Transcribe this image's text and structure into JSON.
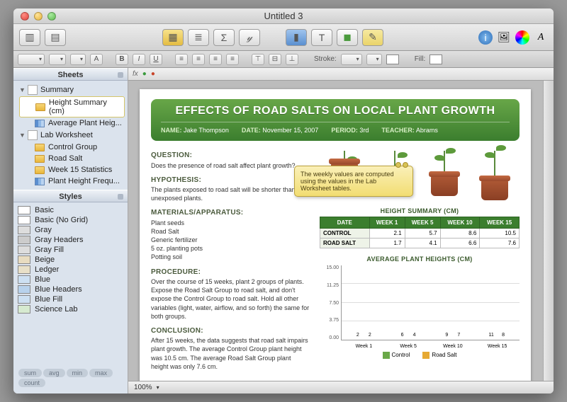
{
  "window": {
    "title": "Untitled 3"
  },
  "formatBar": {
    "stroke_label": "Stroke:",
    "fill_label": "Fill:"
  },
  "sidebar": {
    "sheets_header": "Sheets",
    "styles_header": "Styles",
    "groups": [
      {
        "name": "Summary",
        "items": [
          {
            "label": "Height Summary (cm)",
            "type": "table",
            "selected": true
          },
          {
            "label": "Average Plant Heig...",
            "type": "chart"
          }
        ]
      },
      {
        "name": "Lab Worksheet",
        "items": [
          {
            "label": "Control Group",
            "type": "table"
          },
          {
            "label": "Road Salt",
            "type": "table"
          },
          {
            "label": "Week 15 Statistics",
            "type": "table"
          },
          {
            "label": "Plant Height Frequ...",
            "type": "chart"
          }
        ]
      }
    ],
    "styles": [
      "Basic",
      "Basic (No Grid)",
      "Gray",
      "Gray Headers",
      "Gray Fill",
      "Beige",
      "Ledger",
      "Blue",
      "Blue Headers",
      "Blue Fill",
      "Science Lab"
    ],
    "aggs": [
      "sum",
      "avg",
      "min",
      "max",
      "count"
    ]
  },
  "report": {
    "title": "EFFECTS OF ROAD SALTS ON LOCAL PLANT GROWTH",
    "meta": {
      "name_label": "NAME:",
      "name": "Jake Thompson",
      "date_label": "DATE:",
      "date": "November 15, 2007",
      "period_label": "PERIOD:",
      "period": "3rd",
      "teacher_label": "TEACHER:",
      "teacher": "Abrams"
    },
    "sections": {
      "question_h": "QUESTION:",
      "question": "Does the presence of road salt affect plant growth?",
      "hypothesis_h": "HYPOTHESIS:",
      "hypothesis": "The plants exposed to road salt will be shorter than the unexposed plants.",
      "materials_h": "MATERIALS/APPARATUS:",
      "materials": "Plant seeds\nRoad Salt\nGeneric fertilizer\n5 oz. planting pots\nPotting soil",
      "procedure_h": "PROCEDURE:",
      "procedure": "Over the course of 15 weeks, plant 2 groups of plants. Expose the Road Salt Group to road salt, and don't expose the Control Group to road salt. Hold all other variables (light, water, airflow, and so forth) the same for both groups.",
      "conclusion_h": "CONCLUSION:",
      "conclusion": "After 15 weeks, the data suggests that road salt impairs plant growth. The average Control Group plant height was 10.5 cm. The average Road Salt Group plant height was only 7.6 cm."
    },
    "table": {
      "caption": "HEIGHT SUMMARY (CM)",
      "headers": [
        "DATE",
        "WEEK 1",
        "WEEK 5",
        "WEEK 10",
        "WEEK 15"
      ],
      "rows": [
        {
          "label": "CONTROL",
          "vals": [
            "2.1",
            "5.7",
            "8.6",
            "10.5"
          ]
        },
        {
          "label": "ROAD SALT",
          "vals": [
            "1.7",
            "4.1",
            "6.6",
            "7.6"
          ]
        }
      ]
    },
    "note": "The weekly values are computed using the values in the Lab Worksheet tables."
  },
  "chart_data": {
    "type": "bar",
    "title": "AVERAGE PLANT HEIGHTS (CM)",
    "categories": [
      "Week 1",
      "Week 5",
      "Week 10",
      "Week 15"
    ],
    "series": [
      {
        "name": "Control",
        "values": [
          2,
          6,
          9,
          11
        ],
        "color": "#6aa848"
      },
      {
        "name": "Road Salt",
        "values": [
          2,
          4,
          7,
          8
        ],
        "color": "#e6a933"
      }
    ],
    "ylim": [
      0,
      15
    ],
    "yticks": [
      15.0,
      11.25,
      7.5,
      3.75,
      0
    ]
  },
  "status": {
    "zoom": "100%"
  }
}
